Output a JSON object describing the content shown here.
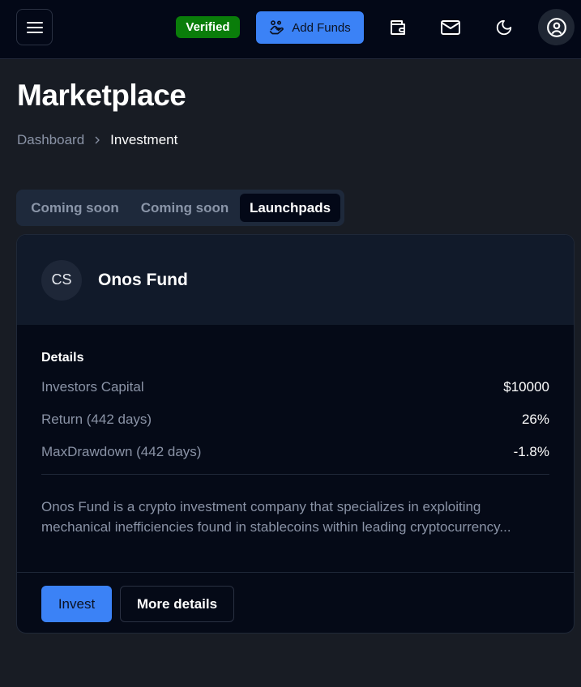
{
  "header": {
    "menu_icon": "hamburger-menu-icon",
    "verified_badge": "Verified",
    "add_funds_label": "Add Funds",
    "add_funds_icon": "hand-coins-icon",
    "wallet_icon": "wallet-icon",
    "mail_icon": "mail-icon",
    "theme_icon": "moon-icon",
    "account_icon": "user-circle-icon"
  },
  "page": {
    "title": "Marketplace",
    "breadcrumb": [
      {
        "label": "Dashboard"
      },
      {
        "label": "Investment"
      }
    ]
  },
  "tabs": [
    {
      "label": "Coming soon",
      "active": false
    },
    {
      "label": "Coming soon",
      "active": false
    },
    {
      "label": "Launchpads",
      "active": true
    }
  ],
  "fund": {
    "avatar_initials": "CS",
    "name": "Onos Fund",
    "details_title": "Details",
    "details": [
      {
        "label": "Investors Capital",
        "value": "$10000"
      },
      {
        "label": "Return (442 days)",
        "value": "26%"
      },
      {
        "label": "MaxDrawdown (442 days)",
        "value": "-1.8%"
      }
    ],
    "description": "Onos Fund is a crypto investment company that specializes in exploiting mechanical inefficiencies found in stablecoins within leading cryptocurrency...",
    "invest_label": "Invest",
    "more_details_label": "More details"
  },
  "colors": {
    "accent": "#3b82f6",
    "verified": "#0a7d0a",
    "background": "#181c24",
    "topbar": "#030817"
  }
}
